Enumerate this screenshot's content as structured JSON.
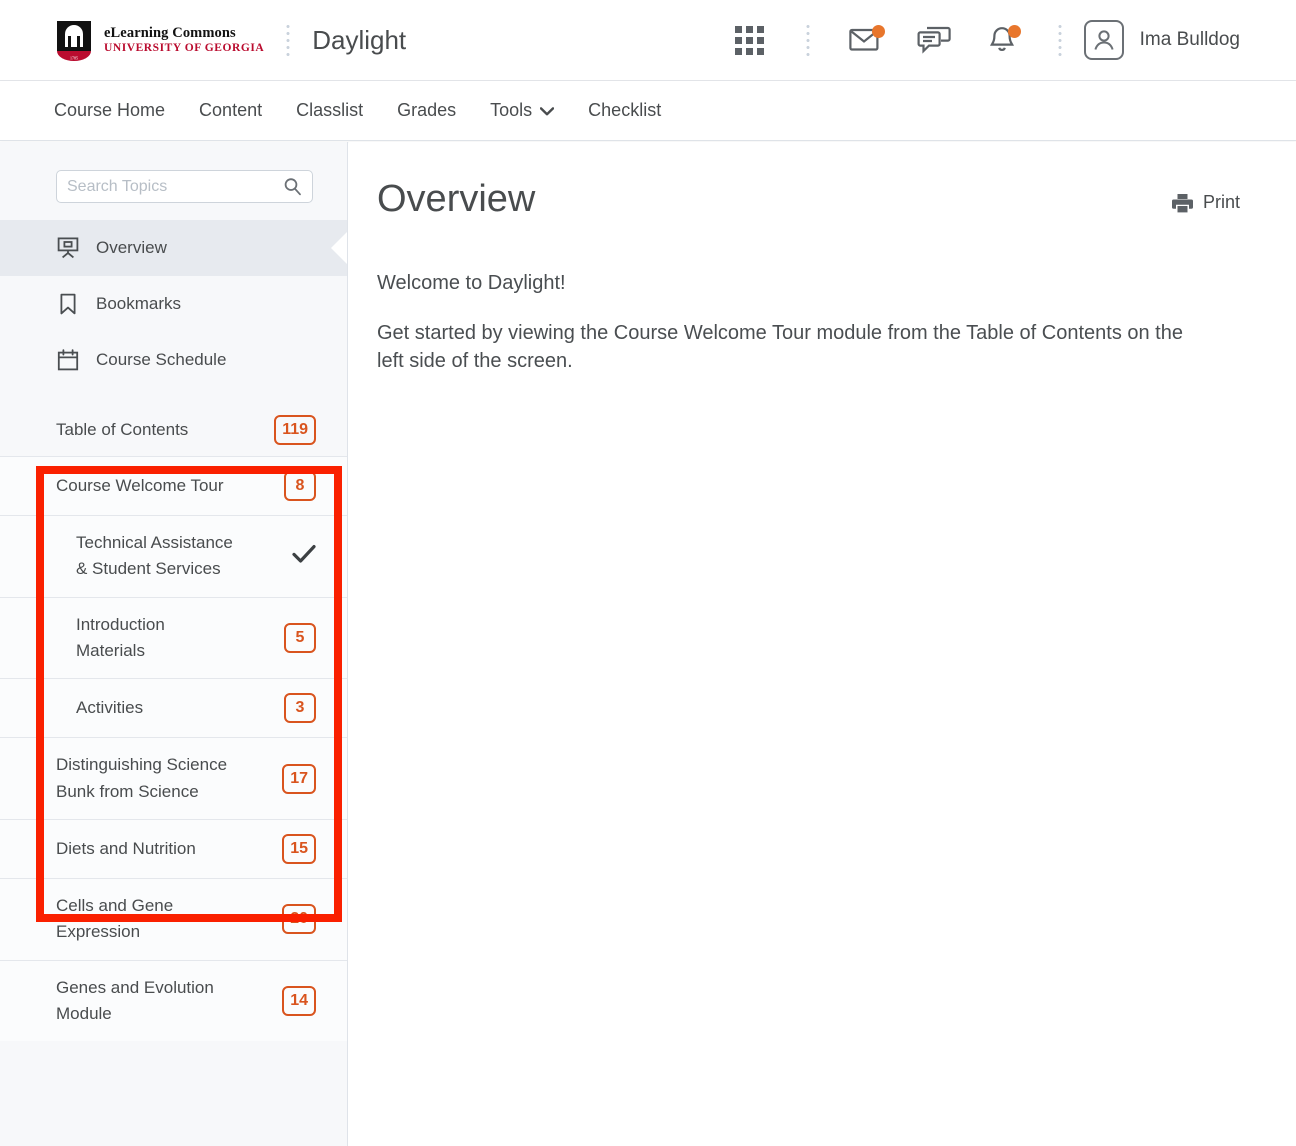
{
  "header": {
    "logo": {
      "line1": "eLearning Commons",
      "line2": "UNIVERSITY OF GEORGIA",
      "icon": "uga-arch-logo"
    },
    "course_title": "Daylight",
    "icons": [
      {
        "name": "waffle-grid-icon",
        "badge": false
      },
      {
        "name": "envelope-icon",
        "badge": true
      },
      {
        "name": "chat-bubble-icon",
        "badge": false
      },
      {
        "name": "bell-icon",
        "badge": true
      }
    ],
    "user": {
      "name": "Ima Bulldog",
      "avatar_icon": "user-avatar-icon"
    }
  },
  "nav": {
    "items": [
      {
        "label": "Course Home",
        "has_chevron": false
      },
      {
        "label": "Content",
        "has_chevron": false
      },
      {
        "label": "Classlist",
        "has_chevron": false
      },
      {
        "label": "Grades",
        "has_chevron": false
      },
      {
        "label": "Tools",
        "has_chevron": true
      },
      {
        "label": "Checklist",
        "has_chevron": false
      }
    ]
  },
  "sidebar": {
    "search": {
      "placeholder": "Search Topics",
      "value": "",
      "icon": "search-icon"
    },
    "links": [
      {
        "label": "Overview",
        "icon": "presentation-screen-icon",
        "active": true
      },
      {
        "label": "Bookmarks",
        "icon": "bookmark-icon",
        "active": false
      },
      {
        "label": "Course Schedule",
        "icon": "calendar-icon",
        "active": false
      }
    ],
    "toc": {
      "title": "Table of Contents",
      "count": "119"
    },
    "modules": [
      {
        "label": "Course Welcome Tour",
        "count": "8",
        "sub": false,
        "check": false
      },
      {
        "label": "Technical Assistance & Student Services",
        "count": "",
        "sub": true,
        "check": true
      },
      {
        "label": "Introduction Materials",
        "count": "5",
        "sub": true,
        "check": false
      },
      {
        "label": "Activities",
        "count": "3",
        "sub": true,
        "check": false
      },
      {
        "label": "Distinguishing Science Bunk from Science",
        "count": "17",
        "sub": false,
        "check": false
      },
      {
        "label": "Diets and Nutrition",
        "count": "15",
        "sub": false,
        "check": false
      },
      {
        "label": "Cells and Gene Expression",
        "count": "20",
        "sub": false,
        "check": false
      },
      {
        "label": "Genes and Evolution Module",
        "count": "14",
        "sub": false,
        "check": false
      }
    ]
  },
  "main": {
    "title": "Overview",
    "print_label": "Print",
    "print_icon": "printer-icon",
    "welcome_heading": "Welcome to Daylight!",
    "body_paragraph": "Get started by viewing the Course Welcome Tour module from the Table of Contents on the left side of the screen."
  },
  "colors": {
    "accent_orange": "#d9541e",
    "badge_dot": "#e8762c",
    "brand_red": "#ba0c2f",
    "highlight_red": "#fa2000",
    "text": "#494c4e"
  }
}
